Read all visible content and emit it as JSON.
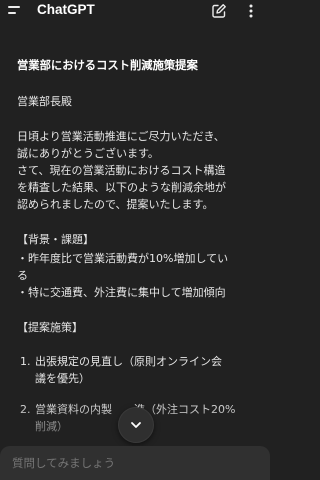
{
  "appbar": {
    "title": "ChatGPT",
    "menu_icon": "hamburger-menu-icon",
    "compose_icon": "edit-compose-icon",
    "more_icon": "more-vertical-icon"
  },
  "message": {
    "title": "営業部におけるコスト削減施策提案",
    "addressee": "営業部長殿",
    "intro": "日頃より営業活動推進にご尽力いただき、\n誠にありがとうございます。\nさて、現在の営業活動におけるコスト構造\nを精査した結果、以下のような削減余地が\n認められましたので、提案いたします。",
    "background_heading": "【背景・課題】",
    "background_points": "・昨年度比で営業活動費が10%増加してい\nる\n・特に交通費、外注費に集中して増加傾向",
    "proposal_heading": "【提案施策】",
    "proposals": [
      {
        "num": "1.",
        "text": "出張規定の見直し（原則オンライン会\n議を優先）"
      },
      {
        "num": "2.",
        "text": "営業資料の内製　　進（外注コスト20%\n削減）"
      }
    ]
  },
  "scroll_button": {
    "icon": "chevron-down-icon"
  },
  "composer": {
    "placeholder": "質問してみましょう"
  },
  "colors": {
    "background": "#212121",
    "composer": "#303030",
    "text": "#ececec"
  }
}
